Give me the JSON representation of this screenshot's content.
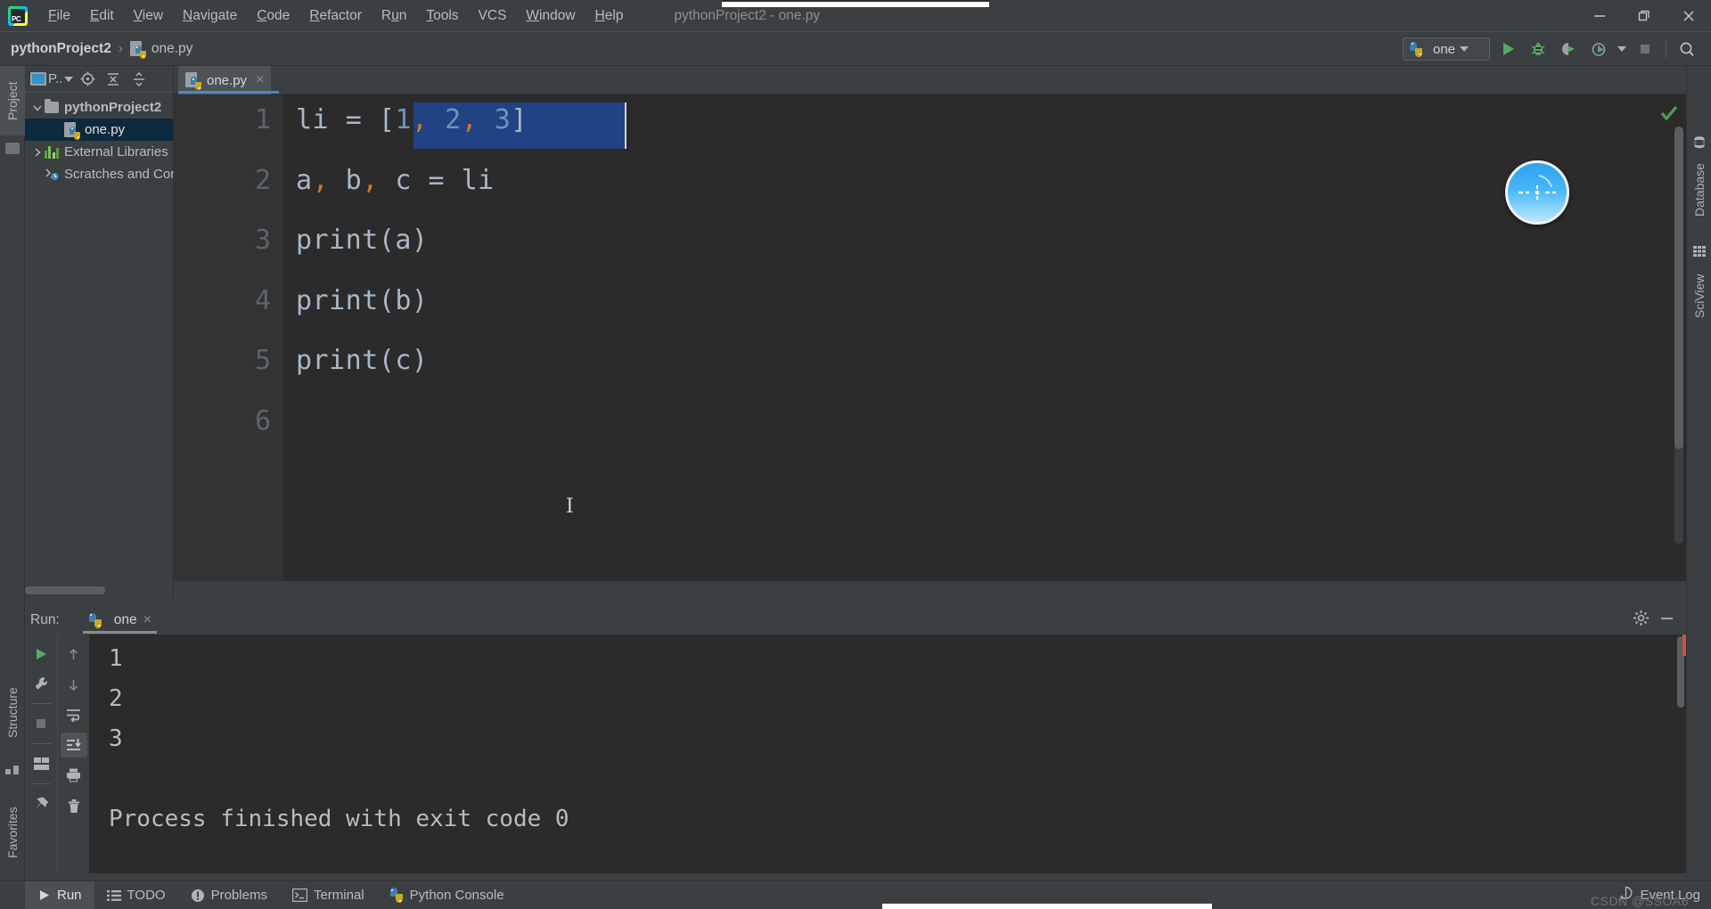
{
  "window": {
    "title": "pythonProject2 - one.py",
    "controls": [
      {
        "name": "minimize-button",
        "glyph": "minimize"
      },
      {
        "name": "maximize-button",
        "glyph": "restore"
      },
      {
        "name": "close-button",
        "glyph": "close"
      }
    ]
  },
  "menubar": {
    "logo_text": "PC",
    "items": [
      {
        "label": "File",
        "mnemonic": "F"
      },
      {
        "label": "Edit",
        "mnemonic": "E"
      },
      {
        "label": "View",
        "mnemonic": "V"
      },
      {
        "label": "Navigate",
        "mnemonic": "N"
      },
      {
        "label": "Code",
        "mnemonic": "C"
      },
      {
        "label": "Refactor",
        "mnemonic": "R"
      },
      {
        "label": "Run",
        "mnemonic": "u"
      },
      {
        "label": "Tools",
        "mnemonic": "T"
      },
      {
        "label": "VCS",
        "mnemonic": ""
      },
      {
        "label": "Window",
        "mnemonic": "W"
      },
      {
        "label": "Help",
        "mnemonic": "H"
      }
    ]
  },
  "navbar": {
    "breadcrumbs": [
      {
        "label": "pythonProject2",
        "icon": "none"
      },
      {
        "label": "one.py",
        "icon": "python-file-icon"
      }
    ],
    "separator": "›",
    "run_config": {
      "label": "one",
      "icon": "python-icon"
    },
    "toolbar_icons": [
      {
        "name": "run-button",
        "glyph": "play"
      },
      {
        "name": "debug-button",
        "glyph": "bug"
      },
      {
        "name": "run-coverage-button",
        "glyph": "coverage"
      },
      {
        "name": "profile-button",
        "glyph": "profile"
      },
      {
        "name": "profile-dropdown",
        "glyph": "caret"
      },
      {
        "name": "stop-button",
        "glyph": "stop"
      },
      {
        "name": "search-everywhere-button",
        "glyph": "magnifier"
      }
    ]
  },
  "left_strip": {
    "tabs": [
      {
        "label": "Project",
        "name": "tool-tab-project",
        "selected": true
      },
      {
        "label": "Structure",
        "name": "tool-tab-structure",
        "selected": false
      },
      {
        "label": "Favorites",
        "name": "tool-tab-favorites",
        "selected": false
      }
    ]
  },
  "right_strip": {
    "tabs": [
      {
        "label": "Database",
        "name": "tool-tab-database"
      },
      {
        "label": "SciView",
        "name": "tool-tab-sciview"
      }
    ]
  },
  "project_panel": {
    "selector_label": "P..",
    "toolbar_icons": [
      {
        "name": "project-view-selector",
        "glyph": "window"
      },
      {
        "name": "scroll-from-source-icon",
        "glyph": "target"
      },
      {
        "name": "expand-all-icon",
        "glyph": "expand"
      },
      {
        "name": "collapse-all-icon",
        "glyph": "collapse"
      }
    ],
    "tree": [
      {
        "label": "pythonProject2",
        "icon": "folder-icon",
        "depth": 0,
        "expanded": true,
        "bold": true,
        "selected": false
      },
      {
        "label": "one.py",
        "icon": "python-file-icon",
        "depth": 1,
        "expanded": null,
        "bold": false,
        "selected": true
      },
      {
        "label": "External Libraries",
        "icon": "library-icon",
        "depth": 0,
        "expanded": false,
        "bold": false,
        "selected": false
      },
      {
        "label": "Scratches and Consoles",
        "icon": "scratches-icon",
        "depth": 0,
        "expanded": null,
        "bold": false,
        "selected": false
      }
    ]
  },
  "editor": {
    "tab": {
      "label": "one.py",
      "close": "×",
      "icon": "python-file-icon"
    },
    "inspection_status": "ok",
    "lines": [
      {
        "n": "1",
        "tokens": [
          {
            "t": "li ",
            "c": "ident"
          },
          {
            "t": "= ",
            "c": "ident"
          },
          {
            "t": "[",
            "c": "ident",
            "sel": true
          },
          {
            "t": "1",
            "c": "num",
            "sel": true
          },
          {
            "t": ",",
            "c": "comma",
            "sel": true
          },
          {
            "t": " ",
            "c": "ident",
            "sel": true
          },
          {
            "t": "2",
            "c": "num",
            "sel": true
          },
          {
            "t": ",",
            "c": "comma",
            "sel": true
          },
          {
            "t": " ",
            "c": "ident",
            "sel": true
          },
          {
            "t": "3",
            "c": "num",
            "sel": true
          },
          {
            "t": "]",
            "c": "ident",
            "sel": true
          }
        ],
        "plain": "li = [1, 2, 3]"
      },
      {
        "n": "2",
        "tokens": [],
        "plain": "a, b, c = li"
      },
      {
        "n": "3",
        "tokens": [],
        "plain": "print(a)"
      },
      {
        "n": "4",
        "tokens": [],
        "plain": "print(b)"
      },
      {
        "n": "5",
        "tokens": [],
        "plain": "print(c)"
      },
      {
        "n": "6",
        "tokens": [],
        "plain": ""
      }
    ],
    "selected_text": "[1, 2, 3]"
  },
  "run_panel": {
    "label": "Run:",
    "tab": {
      "label": "one",
      "close": "×",
      "icon": "python-icon"
    },
    "gear_icon": "settings-icon",
    "minimize_icon": "hide-icon",
    "left_icons": [
      {
        "name": "rerun-button",
        "glyph": "play"
      },
      {
        "name": "edit-configurations-button",
        "glyph": "wrench"
      },
      {
        "name": "stop-button",
        "glyph": "stop"
      },
      {
        "name": "layout-button",
        "glyph": "layout"
      },
      {
        "name": "pin-tab-button",
        "glyph": "pin"
      }
    ],
    "right_icons": [
      {
        "name": "previous-occurrence-button",
        "glyph": "up-arrow"
      },
      {
        "name": "next-occurrence-button",
        "glyph": "down-arrow"
      },
      {
        "name": "soft-wrap-button",
        "glyph": "wrap"
      },
      {
        "name": "scroll-to-end-button",
        "glyph": "scroll-end",
        "active": true
      },
      {
        "name": "print-button",
        "glyph": "printer"
      },
      {
        "name": "clear-all-button",
        "glyph": "trash"
      }
    ],
    "output": [
      "1",
      "2",
      "3",
      "",
      "Process finished with exit code 0"
    ]
  },
  "statusbar": {
    "items": [
      {
        "label": "Run",
        "icon": "play-icon",
        "selected": true,
        "name": "status-tab-run"
      },
      {
        "label": "TODO",
        "icon": "todo-icon",
        "selected": false,
        "name": "status-tab-todo"
      },
      {
        "label": "Problems",
        "icon": "problems-icon",
        "selected": false,
        "name": "status-tab-problems"
      },
      {
        "label": "Terminal",
        "icon": "terminal-icon",
        "selected": false,
        "name": "status-tab-terminal"
      },
      {
        "label": "Python Console",
        "icon": "python-icon",
        "selected": false,
        "name": "status-tab-python-console"
      }
    ],
    "event_log": {
      "label": "Event Log",
      "icon": "balloon-icon"
    },
    "watermark": "CSDN @SSOA6"
  },
  "colors": {
    "chrome": "#3c3f41",
    "editor_bg": "#2b2b2b",
    "gutter_bg": "#313335",
    "selection": "#214283",
    "accent_blue": "#4a88c7",
    "number_token": "#6897bb",
    "comma_token": "#cc7832",
    "text_token": "#a9b7c6",
    "tree_selected": "#0d293e",
    "green_run": "#59a869"
  }
}
